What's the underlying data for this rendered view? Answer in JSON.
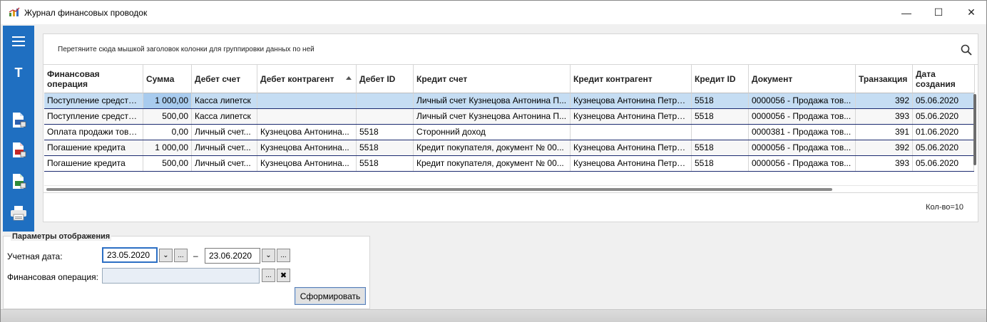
{
  "window": {
    "title": "Журнал финансовых проводок",
    "minimize": "—",
    "maximize": "☐",
    "close": "✕"
  },
  "sidebar": {
    "icons": [
      "menu-icon",
      "text-icon",
      "export-word-icon",
      "export-pdf-icon",
      "export-excel-icon",
      "print-icon"
    ],
    "text_icon_label": "T"
  },
  "grid": {
    "group_hint": "Перетяните сюда мышкой заголовок колонки для группировки данных по ней",
    "columns": [
      "Финансовая операция",
      "Сумма",
      "Дебет счет",
      "Дебет контрагент",
      "Дебет ID",
      "Кредит счет",
      "Кредит контрагент",
      "Кредит ID",
      "Документ",
      "Транзакция",
      "Дата создания"
    ],
    "rows": [
      [
        "Поступление средств...",
        "1 000,00",
        "Касса липетск",
        "",
        "",
        "Личный счет Кузнецова Антонина П...",
        "Кузнецова Антонина Петро...",
        "5518",
        "0000056 - Продажа тов...",
        "392",
        "05.06.2020"
      ],
      [
        "Поступление средств...",
        "500,00",
        "Касса липетск",
        "",
        "",
        "Личный счет Кузнецова Антонина П...",
        "Кузнецова Антонина Петро...",
        "5518",
        "0000056 - Продажа тов...",
        "393",
        "05.06.2020"
      ],
      [
        "Оплата продажи това...",
        "0,00",
        "Личный счет...",
        "Кузнецова Антонина...",
        "5518",
        "Сторонний доход",
        "",
        "",
        "0000381 - Продажа тов...",
        "391",
        "01.06.2020"
      ],
      [
        "Погашение кредита",
        "1 000,00",
        "Личный счет...",
        "Кузнецова Антонина...",
        "5518",
        "Кредит покупателя, документ № 00...",
        "Кузнецова Антонина Петро...",
        "5518",
        "0000056 - Продажа тов...",
        "392",
        "05.06.2020"
      ],
      [
        "Погашение кредита",
        "500,00",
        "Личный счет...",
        "Кузнецова Антонина...",
        "5518",
        "Кредит покупателя, документ № 00...",
        "Кузнецова Антонина Петро...",
        "5518",
        "0000056 - Продажа тов...",
        "393",
        "05.06.2020"
      ]
    ],
    "selected_row": 0,
    "sorted_column": "Дебет контрагент",
    "count": "Кол-во=10"
  },
  "params": {
    "title": "Параметры отображения",
    "date_label": "Учетная дата:",
    "date_from": "23.05.2020",
    "date_to": "23.06.2020",
    "dash": "–",
    "operation_label": "Финансовая операция:",
    "operation_value": "",
    "dropdown_glyph": "⌄",
    "ellipsis_glyph": "...",
    "clear_glyph": "✖",
    "submit": "Сформировать"
  },
  "colors": {
    "sidebar": "#1f6fc1",
    "selection": "#c5ddf3",
    "row_separator": "#1b2a6f"
  }
}
